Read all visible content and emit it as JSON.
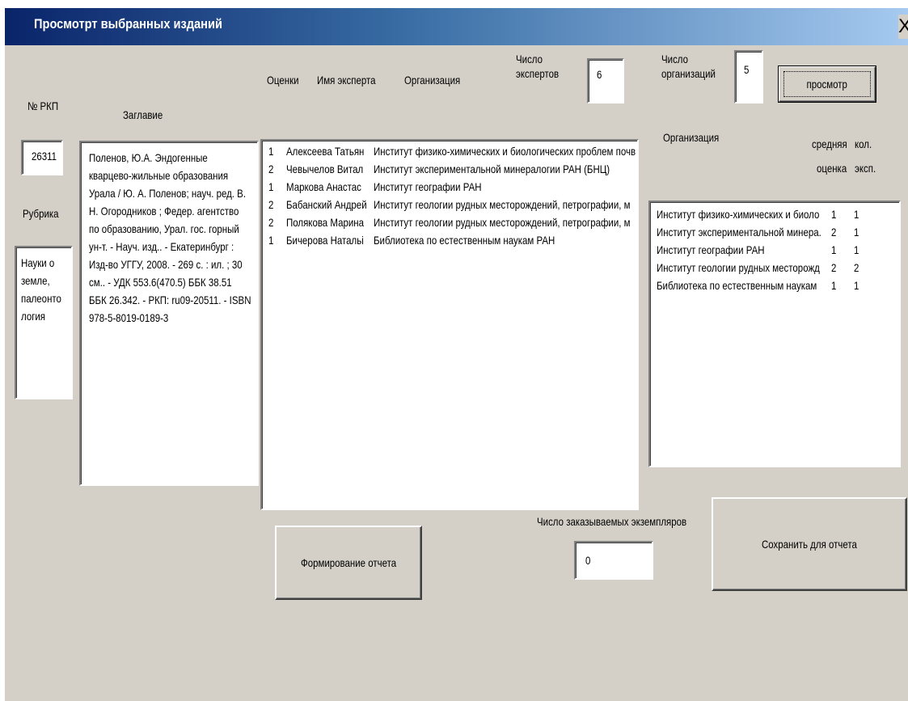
{
  "window": {
    "title": "Просмотрт выбранных изданий",
    "close_label": "X"
  },
  "labels": {
    "rkp_no": "№ РКП",
    "title": "Заглавие",
    "rubric": "Рубрика",
    "grades": "Оценки",
    "expert_name": "Имя эксперта",
    "organization": "Организация",
    "experts_count_1": "Число",
    "experts_count_2": "экспертов",
    "orgs_count_1": "Число",
    "orgs_count_2": "организаций",
    "org_col": "Организация",
    "avg_1": "средняя",
    "avg_2": "оценка",
    "cnt_1": "кол.",
    "cnt_2": "эксп.",
    "copies_count": "Число заказываемых экземпляров"
  },
  "fields": {
    "rkp_no": "26311",
    "rubric": "Науки о земле, палеонто логия",
    "title_text": "Поленов, Ю.А. Эндогенные кварцево-жильные образования Урала / Ю. А. Поленов; науч. ред. В. Н. Огородников ; Федер. агентство по образованию, Урал. гос. горный ун-т. - Науч. изд.. - Екатеринбург : Изд-во УГГУ, 2008. - 269 с. : ил. ; 30 см.. - УДК 553.6(470.5) ББК 38.51 ББК 26.342. - РКП: ru09-20511. - ISBN 978-5-8019-0189-3",
    "experts_count": "6",
    "orgs_count": "5",
    "copies_count": "0"
  },
  "buttons": {
    "view": "просмотр",
    "make_report": "Формирование отчета",
    "save_report": "Сохранить для отчета"
  },
  "experts": [
    {
      "grade": "1",
      "name": "Алексеева Татьян",
      "org": "Институт физико-химических и биологических проблем почв"
    },
    {
      "grade": "2",
      "name": "Чевычелов Витал",
      "org": "Институт экспериментальной минералогии РАН (БНЦ)"
    },
    {
      "grade": "1",
      "name": "Маркова Анастас",
      "org": "Институт географии РАН"
    },
    {
      "grade": "2",
      "name": "Бабанский Андрей",
      "org": "Институт геологии рудных месторождений, петрографии, м"
    },
    {
      "grade": "2",
      "name": "Полякова Марина",
      "org": "Институт геологии рудных месторождений, петрографии, м"
    },
    {
      "grade": "1",
      "name": "Бичерова Натальi",
      "org": "Библиотека по естественным наукам РАН"
    }
  ],
  "orgs": [
    {
      "name": "Институт физико-химических и биоло",
      "avg": "1",
      "count": "1"
    },
    {
      "name": "Институт экспериментальной минера.",
      "avg": "2",
      "count": "1"
    },
    {
      "name": "Институт географии РАН",
      "avg": "1",
      "count": "1"
    },
    {
      "name": "Институт геологии рудных месторожд",
      "avg": "2",
      "count": "2"
    },
    {
      "name": "Библиотека по естественным наукам",
      "avg": "1",
      "count": "1"
    }
  ]
}
